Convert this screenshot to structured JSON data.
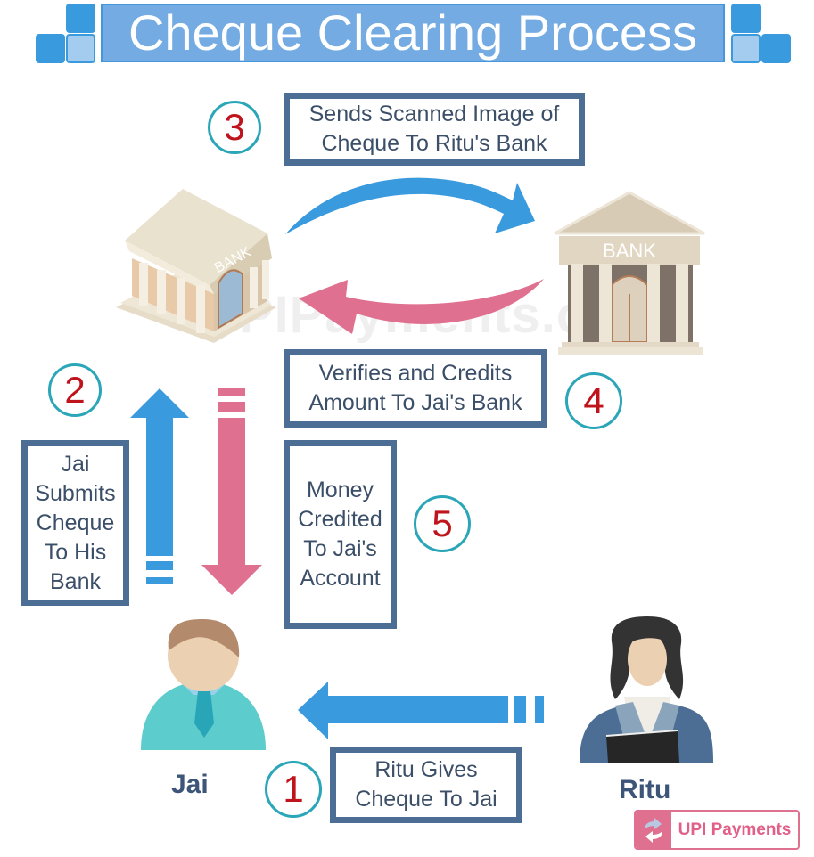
{
  "title": "Cheque Clearing Process",
  "colors": {
    "title_bg": "#73abe2",
    "accent_blue": "#3a9ade",
    "accent_pink": "#e07090",
    "box_border": "#4c6e94",
    "step_ring": "#2aa6b8",
    "step_number": "#c0141c",
    "text": "#3c4f68"
  },
  "steps": [
    {
      "number": "1",
      "lines": [
        "Ritu Gives",
        "Cheque To Jai"
      ]
    },
    {
      "number": "2",
      "lines": [
        "Jai",
        "Submits",
        "Cheque",
        "To His",
        "Bank"
      ]
    },
    {
      "number": "3",
      "lines": [
        "Sends Scanned Image of",
        "Cheque To Ritu's Bank"
      ]
    },
    {
      "number": "4",
      "lines": [
        "Verifies and Credits",
        "Amount To Jai's Bank"
      ]
    },
    {
      "number": "5",
      "lines": [
        "Money",
        "Credited",
        "To Jai's",
        "Account"
      ]
    }
  ],
  "banks": {
    "left_label": "BANK",
    "right_label": "BANK"
  },
  "people": {
    "jai": "Jai",
    "ritu": "Ritu"
  },
  "watermark": "UPIPayments.co.in",
  "logo": {
    "text": "UPI Payments",
    "icon": "exchange-arrows-icon"
  }
}
